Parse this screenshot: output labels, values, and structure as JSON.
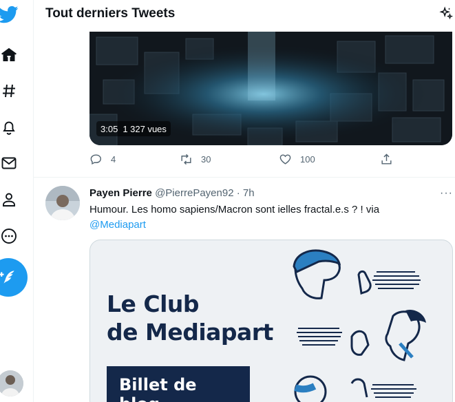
{
  "header": {
    "title": "Tout derniers Tweets",
    "sparkle_icon": "sparkle-icon"
  },
  "sidebar": {
    "items": [
      {
        "name": "twitter-logo",
        "icon": "bird-icon"
      },
      {
        "name": "home",
        "icon": "home-icon"
      },
      {
        "name": "explore",
        "icon": "hashtag-icon"
      },
      {
        "name": "notifications",
        "icon": "bell-icon"
      },
      {
        "name": "messages",
        "icon": "envelope-icon"
      },
      {
        "name": "profile",
        "icon": "person-icon"
      },
      {
        "name": "more",
        "icon": "more-circle-icon"
      },
      {
        "name": "compose",
        "icon": "feather-plus-icon"
      }
    ]
  },
  "tweet1": {
    "video": {
      "duration": "3:05",
      "views": "1 327 vues"
    },
    "actions": {
      "replies": "4",
      "retweets": "30",
      "likes": "100"
    }
  },
  "tweet2": {
    "name": "Payen Pierre",
    "handle": "@PierrePayen92",
    "separator": "·",
    "time": "7h",
    "more": "···",
    "text": "Humour. Les homo sapiens/Macron sont ielles fractal.e.s ? ! via",
    "mention": "@Mediapart",
    "card": {
      "title_line1": "Le Club",
      "title_line2": "de Mediapart",
      "badge": "Billet de blog"
    }
  },
  "colors": {
    "accent": "#1d9bf0",
    "text": "#0f1419",
    "muted": "#536471",
    "card_navy": "#14284a"
  }
}
